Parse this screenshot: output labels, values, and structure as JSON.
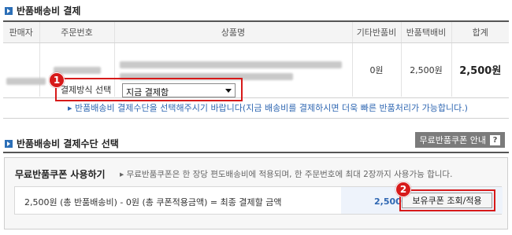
{
  "section1": {
    "title": "반품배송비 결제"
  },
  "table": {
    "headers": [
      "판매자",
      "주문번호",
      "상품명",
      "기타반품비",
      "반품택배비",
      "합계"
    ],
    "row": {
      "etc_fee": "0원",
      "delivery_fee": "2,500원",
      "total": "2,500원"
    }
  },
  "payment": {
    "label": "결제방식 선택",
    "selected": "지금 결제함",
    "notice": "반품배송비 결제수단을 선택해주시기 바랍니다(지금 배송비를 결제하시면 더욱 빠른 반품처리가 가능합니다.)"
  },
  "section2": {
    "title": "반품배송비 결제수단 선택",
    "guide_button": "무료반품쿠폰 안내",
    "guide_icon": "?"
  },
  "coupon": {
    "title": "무료반품쿠폰 사용하기",
    "description": "무료반품쿠폰은 한 장당 편도배송비에 적용되며, 한 주문번호에 최대 2장까지 사용가능 합니다.",
    "calc": "2,500원 (총 반품배송비) - 0원 (총 쿠폰적용금액) = 최종 결제할 금액",
    "amount": "2,500원",
    "apply_button": "보유쿠폰 조회/적용"
  },
  "callouts": [
    "1",
    "2"
  ],
  "colors": {
    "accent": "#2c6fb7",
    "callout": "#d71a1a",
    "notice": "#2f67b2"
  }
}
